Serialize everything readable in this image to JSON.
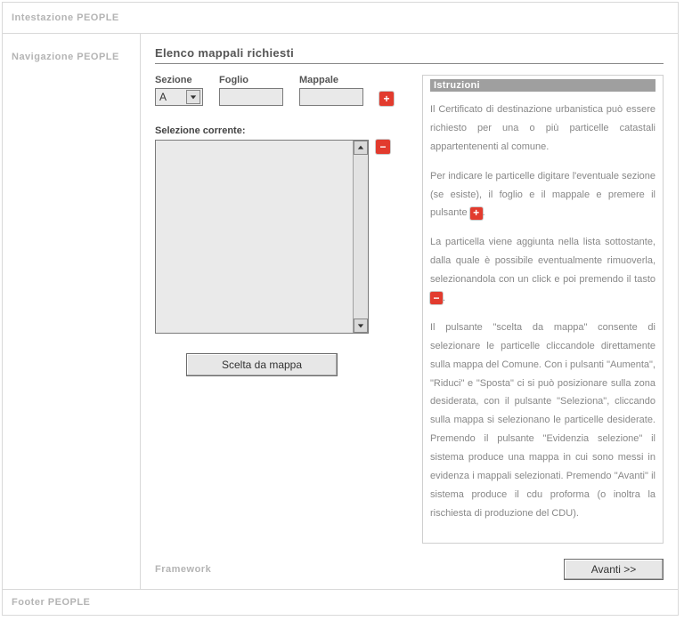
{
  "header": {
    "title": "Intestazione PEOPLE"
  },
  "nav": {
    "title": "Navigazione PEOPLE"
  },
  "main": {
    "title": "Elenco mappali richiesti",
    "fields": {
      "sezione_label": "Sezione",
      "sezione_value": "A",
      "foglio_label": "Foglio",
      "foglio_value": "",
      "mappale_label": "Mappale",
      "mappale_value": ""
    },
    "selection_label": "Selezione corrente:",
    "choose_from_map_label": "Scelta da mappa"
  },
  "instructions": {
    "title": "Istruzioni",
    "p1": "Il Certificato di destinazione urbanistica può essere richiesto per una o più particelle catastali appartentenenti al comune.",
    "p2a": "Per indicare le particelle digitare l'eventuale sezione (se esiste), il foglio e il mappale e premere il pulsante ",
    "p2b": ".",
    "p3a": "La particella viene aggiunta nella lista sottostante, dalla quale è possibile eventualmente rimuoverla, selezionandola con un click e poi premendo il tasto ",
    "p3b": ".",
    "p4": "Il pulsante \"scelta da mappa\" consente di selezionare le particelle cliccandole direttamente sulla mappa del Comune. Con i pulsanti \"Aumenta\", \"Riduci\" e \"Sposta\" ci si può posizionare sulla zona desiderata, con il pulsante \"Seleziona\", cliccando sulla mappa si selezionano le particelle desiderate. Premendo il pulsante \"Evidenzia selezione\" il sistema produce una mappa in cui sono messi in evidenza i mappali selezionati. Premendo \"Avanti\" il sistema produce il cdu proforma (o inoltra la rischiesta di produzione del CDU)."
  },
  "footer_inner": {
    "framework": "Framework",
    "next": "Avanti >>"
  },
  "footer": {
    "title": "Footer PEOPLE"
  }
}
